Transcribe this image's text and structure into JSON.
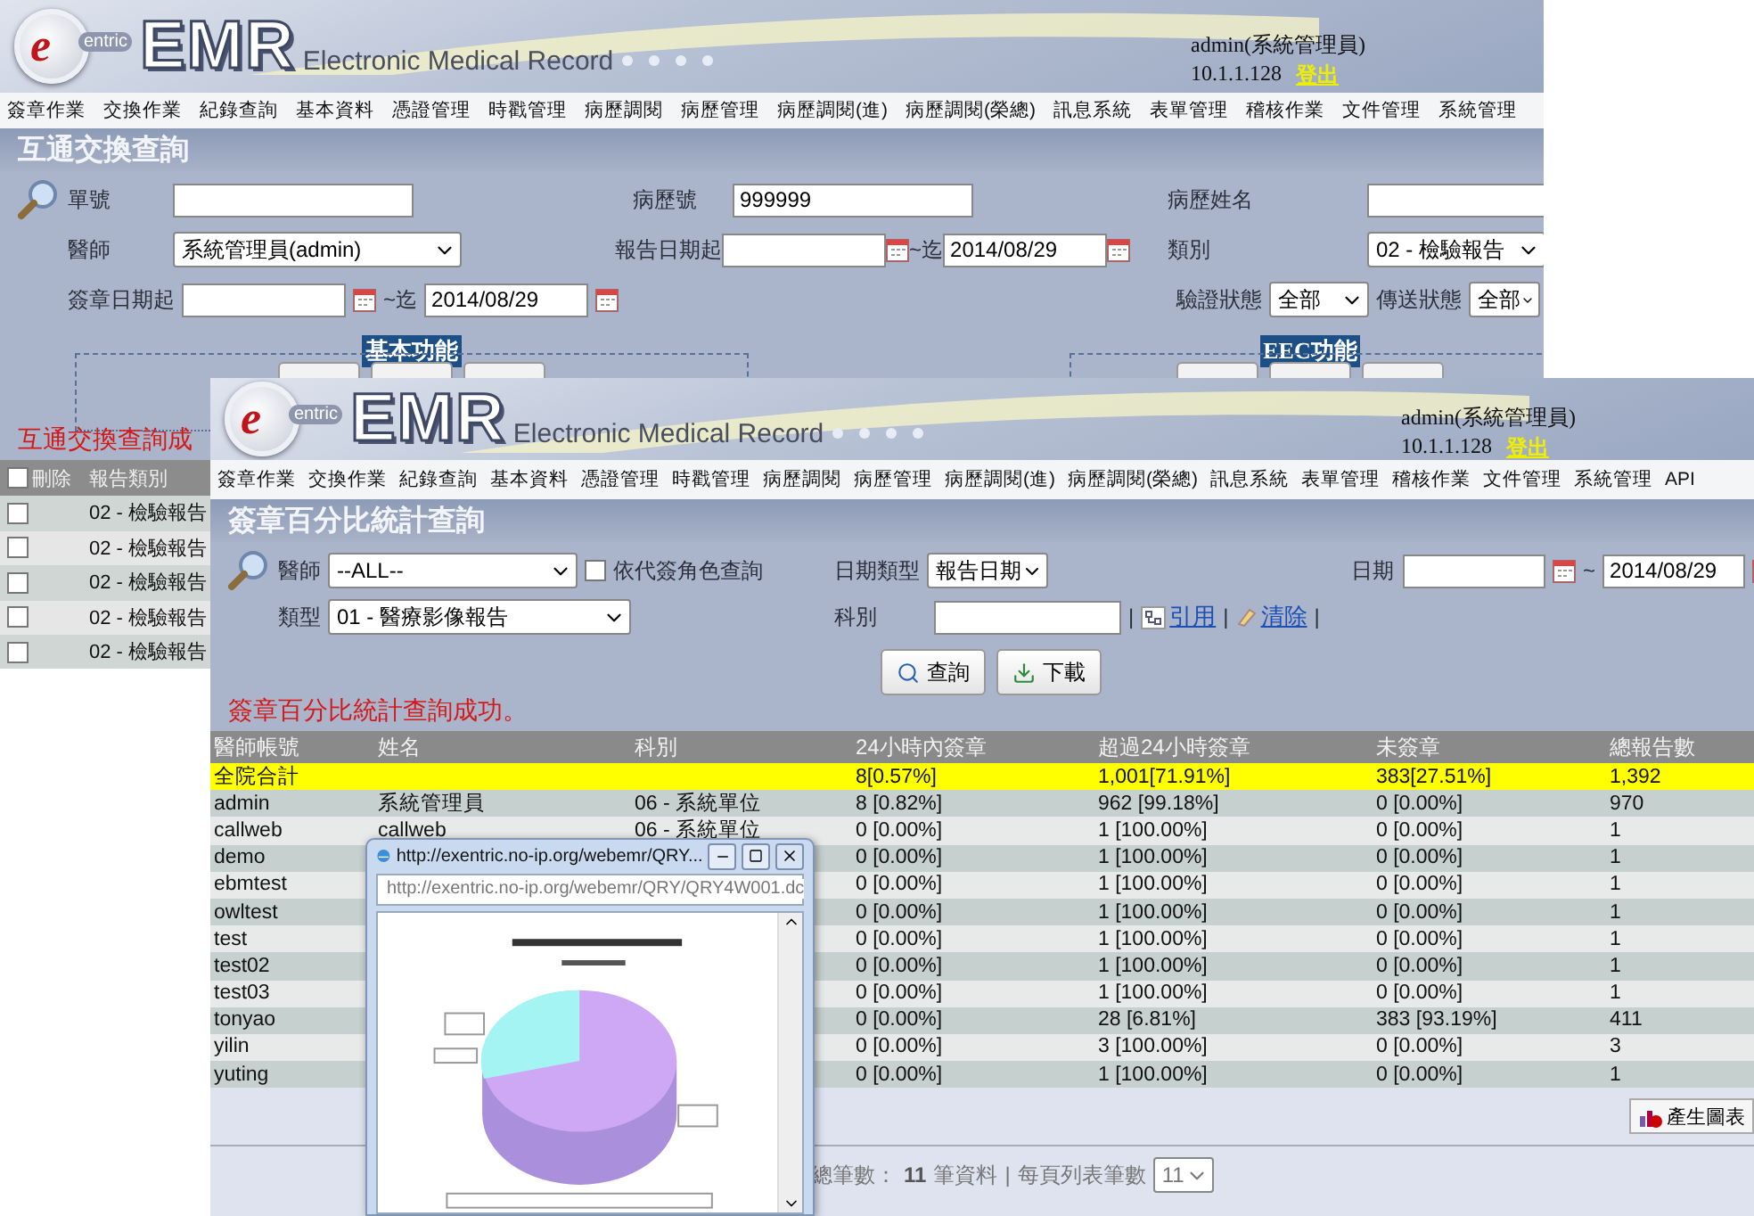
{
  "back_window": {
    "header": {
      "logo_mark": "e",
      "logo_sub": "entric",
      "logo_text": "EMR",
      "tagline": "Electronic Medical Record",
      "user": "admin(系統管理員)",
      "ip": "10.1.1.128",
      "logout": "登出"
    },
    "nav": [
      "簽章作業",
      "交換作業",
      "紀錄查詢",
      "基本資料",
      "憑證管理",
      "時戳管理",
      "病歷調閱",
      "病歷管理",
      "病歷調閱(進)",
      "病歷調閱(榮總)",
      "訊息系統",
      "表單管理",
      "稽核作業",
      "文件管理",
      "系統管理"
    ],
    "page_title": "互通交換查詢",
    "form": {
      "order_no": {
        "label": "單號"
      },
      "chart_no": {
        "label": "病歷號",
        "value": "999999"
      },
      "patient_name": {
        "label": "病歷姓名"
      },
      "doctor": {
        "label": "醫師",
        "value": "系統管理員(admin)"
      },
      "report_date": {
        "label": "報告日期起",
        "to_label": "~迄",
        "to_value": "2014/08/29"
      },
      "category": {
        "label": "類別",
        "value": "02 - 檢驗報告"
      },
      "sign_date": {
        "label": "簽章日期起",
        "to_label": "~迄",
        "to_value": "2014/08/29"
      },
      "verify_status": {
        "label": "驗證狀態",
        "value": "全部"
      },
      "send_status": {
        "label": "傳送狀態",
        "value": "全部"
      }
    },
    "sections": [
      {
        "title": "基本功能"
      },
      {
        "title": "EEC功能"
      }
    ],
    "message": "互通交換查詢成",
    "table": {
      "columns": [
        "刪除",
        "報告類別"
      ],
      "all_checked": false,
      "rows": [
        {
          "checked": false,
          "type": "02 - 檢驗報告"
        },
        {
          "checked": false,
          "type": "02 - 檢驗報告"
        },
        {
          "checked": false,
          "type": "02 - 檢驗報告"
        },
        {
          "checked": false,
          "type": "02 - 檢驗報告"
        },
        {
          "checked": false,
          "type": "02 - 檢驗報告"
        }
      ]
    }
  },
  "front_window": {
    "header": {
      "logo_mark": "e",
      "logo_sub": "entric",
      "logo_text": "EMR",
      "tagline": "Electronic Medical Record",
      "user": "admin(系統管理員)",
      "ip": "10.1.1.128",
      "logout": "登出"
    },
    "nav": [
      "簽章作業",
      "交換作業",
      "紀錄查詢",
      "基本資料",
      "憑證管理",
      "時戳管理",
      "病歷調閱",
      "病歷管理",
      "病歷調閱(進)",
      "病歷調閱(榮總)",
      "訊息系統",
      "表單管理",
      "稽核作業",
      "文件管理",
      "系統管理",
      "API"
    ],
    "page_title": "簽章百分比統計查詢",
    "form": {
      "doctor": {
        "label": "醫師",
        "value": "--ALL--"
      },
      "proxy_role": {
        "label": "依代簽角色查詢",
        "checked": false
      },
      "date_type": {
        "label": "日期類型",
        "value": "報告日期"
      },
      "date": {
        "label": "日期",
        "to_label": "~",
        "to_value": "2014/08/29"
      },
      "type": {
        "label": "類型",
        "value": "01 - 醫療影像報告"
      },
      "department": {
        "label": "科別"
      },
      "links": [
        {
          "kind": "reference",
          "label": "引用"
        },
        {
          "kind": "clear",
          "label": "清除"
        }
      ],
      "separator": "|",
      "buttons": [
        {
          "kind": "search",
          "label": "查詢"
        },
        {
          "kind": "download",
          "label": "下載"
        }
      ]
    },
    "message": "簽章百分比統計查詢成功。",
    "table": {
      "columns": [
        "醫師帳號",
        "姓名",
        "科別",
        "24小時內簽章",
        "超過24小時簽章",
        "未簽章",
        "總報告數"
      ],
      "rows": [
        {
          "highlighted": true,
          "cells": [
            "全院合計",
            "",
            "",
            "8[0.57%]",
            "1,001[71.91%]",
            "383[27.51%]",
            "1,392"
          ]
        },
        {
          "highlighted": false,
          "cells": [
            "admin",
            "系統管理員",
            "06 - 系統單位",
            "8 [0.82%]",
            "962 [99.18%]",
            "0 [0.00%]",
            "970"
          ]
        },
        {
          "highlighted": false,
          "cells": [
            "callweb",
            "callweb",
            "06 - 系統單位",
            "0 [0.00%]",
            "1 [100.00%]",
            "0 [0.00%]",
            "1"
          ]
        },
        {
          "highlighted": false,
          "cells": [
            "demo",
            "",
            "",
            "0 [0.00%]",
            "1 [100.00%]",
            "0 [0.00%]",
            "1"
          ]
        },
        {
          "highlighted": false,
          "cells": [
            "ebmtest",
            "",
            "",
            "0 [0.00%]",
            "1 [100.00%]",
            "0 [0.00%]",
            "1"
          ]
        },
        {
          "highlighted": false,
          "cells": [
            "owltest",
            "",
            "",
            "0 [0.00%]",
            "1 [100.00%]",
            "0 [0.00%]",
            "1"
          ]
        },
        {
          "highlighted": false,
          "cells": [
            "test",
            "",
            "",
            "0 [0.00%]",
            "1 [100.00%]",
            "0 [0.00%]",
            "1"
          ]
        },
        {
          "highlighted": false,
          "cells": [
            "test02",
            "",
            "",
            "0 [0.00%]",
            "1 [100.00%]",
            "0 [0.00%]",
            "1"
          ]
        },
        {
          "highlighted": false,
          "cells": [
            "test03",
            "",
            "",
            "0 [0.00%]",
            "1 [100.00%]",
            "0 [0.00%]",
            "1"
          ]
        },
        {
          "highlighted": false,
          "cells": [
            "tonyao",
            "",
            "",
            "0 [0.00%]",
            "28 [6.81%]",
            "383 [93.19%]",
            "411"
          ]
        },
        {
          "highlighted": false,
          "cells": [
            "yilin",
            "",
            "",
            "0 [0.00%]",
            "3 [100.00%]",
            "0 [0.00%]",
            "3"
          ]
        },
        {
          "highlighted": false,
          "cells": [
            "yuting",
            "",
            "",
            "0 [0.00%]",
            "1 [100.00%]",
            "0 [0.00%]",
            "1"
          ]
        }
      ]
    },
    "chart_button": "產生圖表",
    "pagination": {
      "total_label": "總筆數：",
      "total": "11",
      "total_unit": "筆資料",
      "separator": "|",
      "per_page_label": "每頁列表筆數",
      "per_page": "11"
    }
  },
  "popup": {
    "title": "http://exentric.no-ip.org/webemr/QRY...",
    "address": "http://exentric.no-ip.org/webemr/QRY/QRY4W001.dc"
  }
}
